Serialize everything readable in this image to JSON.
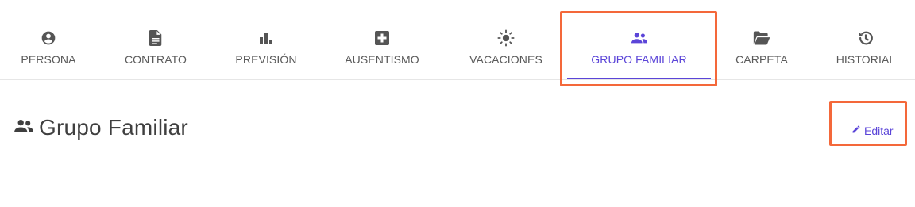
{
  "colors": {
    "accent": "#5b45d8",
    "icon": "#555555",
    "highlight": "#f4683a"
  },
  "tabs": [
    {
      "id": "persona",
      "label": "PERSONA",
      "icon": "account-circle-icon",
      "active": false
    },
    {
      "id": "contrato",
      "label": "CONTRATO",
      "icon": "document-icon",
      "active": false
    },
    {
      "id": "prevision",
      "label": "PREVISIÓN",
      "icon": "bar-chart-icon",
      "active": false
    },
    {
      "id": "ausentismo",
      "label": "AUSENTISMO",
      "icon": "medical-plus-icon",
      "active": false
    },
    {
      "id": "vacaciones",
      "label": "VACACIONES",
      "icon": "sun-icon",
      "active": false
    },
    {
      "id": "grupo_familiar",
      "label": "GRUPO FAMILIAR",
      "icon": "people-icon",
      "active": true
    },
    {
      "id": "carpeta",
      "label": "CARPETA",
      "icon": "folder-open-icon",
      "active": false
    },
    {
      "id": "historial",
      "label": "HISTORIAL",
      "icon": "history-icon",
      "active": false
    }
  ],
  "section": {
    "icon": "people-icon",
    "title": "Grupo Familiar"
  },
  "edit": {
    "icon": "pencil-icon",
    "label": "Editar"
  }
}
